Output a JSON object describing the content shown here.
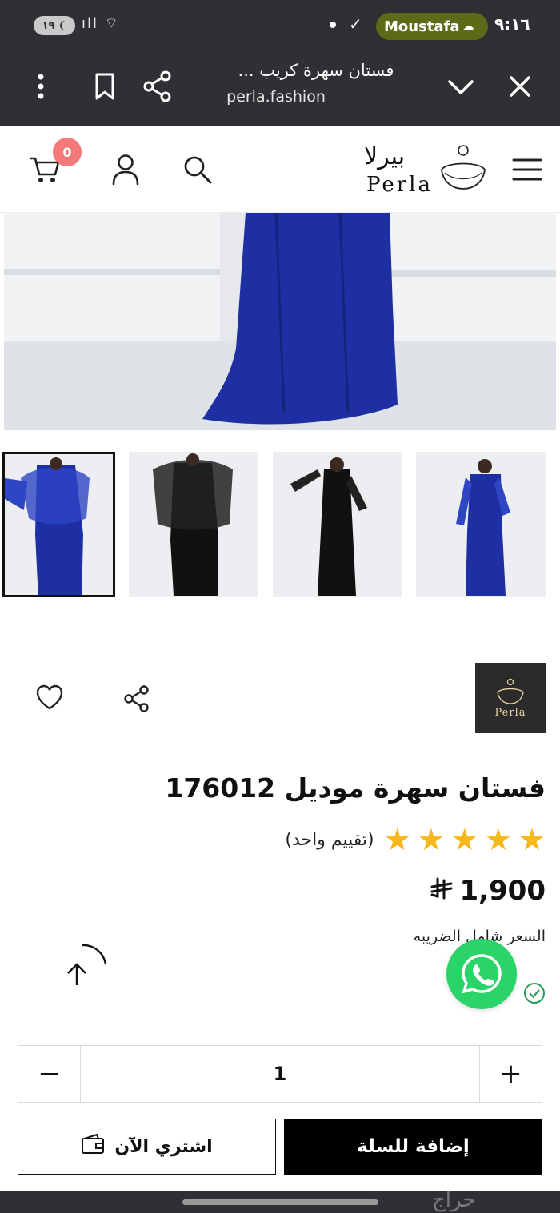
{
  "status_bar": {
    "battery": "١٩",
    "carrier_name": "Moustafa",
    "time": "٩:١٦"
  },
  "browser": {
    "page_title": "فستان سهرة كريب ...",
    "url": "perla.fashion"
  },
  "header": {
    "cart_count": "0",
    "logo_ar": "بيرلا",
    "logo_en": "Perla"
  },
  "brand": {
    "name": "Perla"
  },
  "product": {
    "title": "فستان سهرة موديل 176012",
    "rating_stars": 5,
    "rating_text": "(تقييم واحد)",
    "price": "1,900",
    "currency_symbol": "⃁",
    "tax_note": "السعر شامل الضريبه"
  },
  "purchase": {
    "quantity": "1",
    "decrement": "−",
    "increment": "+",
    "buy_now_label": "اشتري الآن",
    "add_to_cart_label": "إضافة للسلة"
  },
  "colors": {
    "dress_blue": "#1d2fa3",
    "whatsapp_green": "#2bd468",
    "star_gold": "#f6b81a",
    "cart_badge": "#f47a7a"
  },
  "watermark": "حراج"
}
